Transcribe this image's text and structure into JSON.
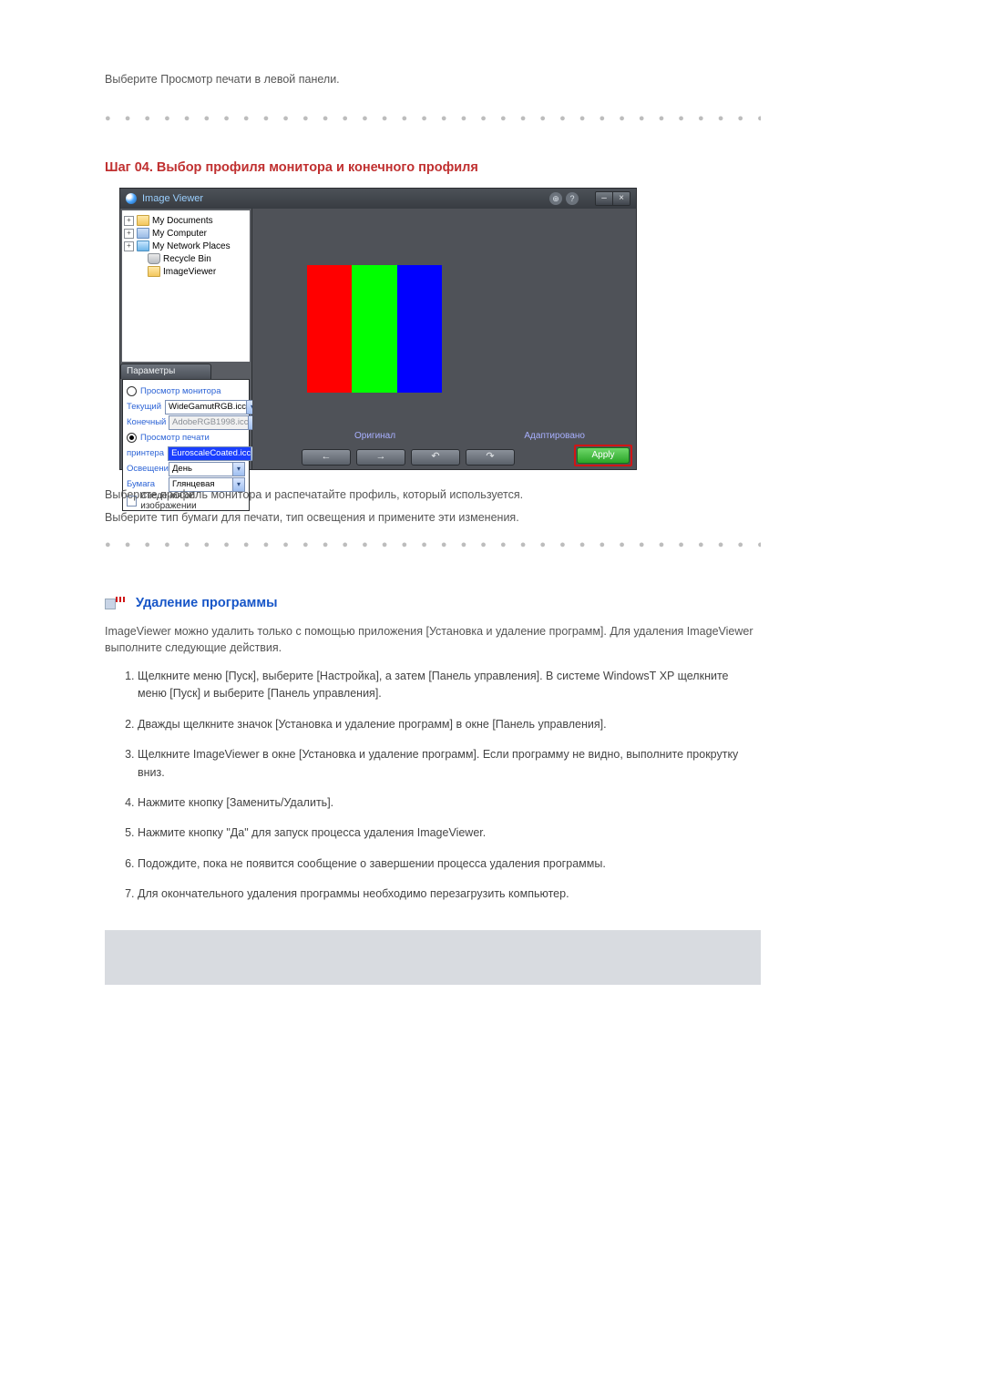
{
  "intro_text": "Выберите Просмотр печати в левой панели.",
  "dots": "● ● ● ● ● ● ● ● ● ● ● ● ● ● ● ● ● ● ● ● ● ● ● ● ● ● ● ● ● ● ● ● ● ● ● ● ● ● ● ● ● ● ● ● ● ●",
  "step_heading": "Шаг 04. Выбор профиля монитора и конечного профиля",
  "iv": {
    "title": "Image Viewer",
    "round_btn1": "⊕",
    "round_btn2": "?",
    "min_btn": "–",
    "close_btn": "×",
    "tree": [
      {
        "exp": "+",
        "icon": "tf-folder",
        "label": "My Documents"
      },
      {
        "exp": "+",
        "icon": "tf-comp",
        "label": "My Computer"
      },
      {
        "exp": "+",
        "icon": "tf-net",
        "label": "My Network Places"
      },
      {
        "exp": "",
        "icon": "tf-bin",
        "label": "Recycle Bin"
      },
      {
        "exp": "",
        "icon": "tf-folder",
        "label": "ImageViewer"
      }
    ],
    "params_tab": "Параметры",
    "params": {
      "monitor_view": "Просмотр монитора",
      "print_view": "Просмотр печати",
      "current_label": "Текущий",
      "current_value": "WideGamutRGB.icc",
      "target_label": "Конечный",
      "target_value": "AdobeRGB1998.icc",
      "printer_label": "принтера",
      "printer_value": "EuroscaleCoated.icc",
      "light_label": "Освещение",
      "light_value": "День",
      "paper_label": "Бумага",
      "paper_value": "Глянцевая",
      "image_info": "Сведения об изображении"
    },
    "caption_left": "Оригинал",
    "caption_right": "Адаптировано",
    "nav": {
      "back": "←",
      "fwd": "→",
      "rotl": "↶",
      "rotr": "↷"
    },
    "apply": "Apply"
  },
  "post": {
    "p1": "Выберите профиль монитора и распечатайте профиль, который используется.",
    "p2": "Выберите тип бумаги для печати, тип освещения и примените эти изменения."
  },
  "section2": {
    "title": "Удаление программы",
    "p1": "ImageViewer можно удалить только с помощью приложения [Установка и удаление программ]. Для удаления ImageViewer выполните следующие действия.",
    "steps": [
      "Щелкните меню [Пуск], выберите [Настройка], а затем [Панель управления]. В системе WindowsТ XP щелкните меню [Пуск] и выберите [Панель управления].",
      "Дважды щелкните значок [Установка и удаление программ] в окне [Панель управления].",
      "Щелкните ImageViewer в окне [Установка и удаление программ]. Если программу не видно, выполните прокрутку вниз.",
      "Нажмите кнопку [Заменить/Удалить].",
      "Нажмите кнопку \"Да\" для запуск процесса удаления ImageViewer.",
      "Подождите, пока не появится сообщение о завершении процесса удаления программы.",
      "Для окончательного удаления программы необходимо перезагрузить компьютер."
    ]
  }
}
